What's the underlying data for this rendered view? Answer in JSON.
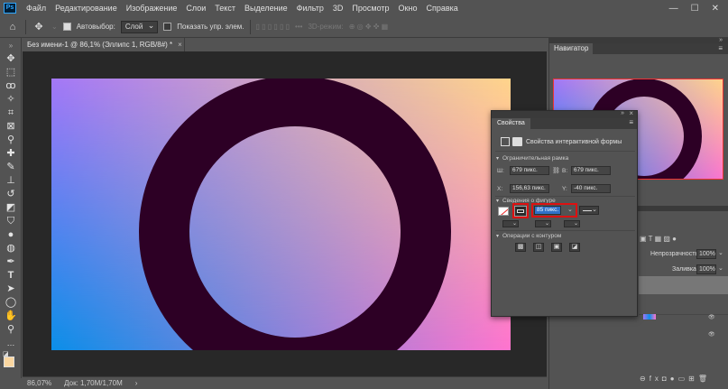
{
  "menubar": {
    "logo": "Ps",
    "items": [
      "Файл",
      "Редактирование",
      "Изображение",
      "Слои",
      "Текст",
      "Выделение",
      "Фильтр",
      "3D",
      "Просмотр",
      "Окно",
      "Справка"
    ],
    "controls": [
      "—",
      "☐",
      "✕"
    ]
  },
  "options": {
    "autoselect_label": "Автовыбор:",
    "autoselect_value": "Слой",
    "show_controls_label": "Показать упр. элем.",
    "mode_label": "3D-режим:"
  },
  "document": {
    "tab_title": "Без имени-1 @ 86,1% (Эллипс 1, RGB/8#) *",
    "tab_close": "×",
    "colors": {
      "ring": "#2d0025",
      "grad_tl": "#a477f7",
      "grad_tr": "#ffd48a",
      "grad_bl": "#0b8fe9",
      "grad_br": "#ff74cf"
    }
  },
  "status": {
    "zoom": "86,07%",
    "doc": "Док: 1,70M/1,70M",
    "arrow": "›"
  },
  "navigator": {
    "title": "Навигатор"
  },
  "properties": {
    "title": "Свойства",
    "subtitle": "Свойства интерактивной формы",
    "bounds_section": "Ограничительная рамка",
    "w_label": "Ш:",
    "w_value": "679 пикс.",
    "h_label": "В:",
    "h_value": "679 пикс.",
    "x_label": "X:",
    "x_value": "156,63 пикс.",
    "y_label": "Y:",
    "y_value": "-40 пикс.",
    "shape_section": "Сведения о фигуре",
    "stroke_value": "85 пикс.",
    "path_section": "Операции с контуром"
  },
  "layers": {
    "opacity_label": "Непрозрачность:",
    "opacity_value": "100%",
    "fill_label": "Заливка:",
    "fill_value": "100%"
  }
}
